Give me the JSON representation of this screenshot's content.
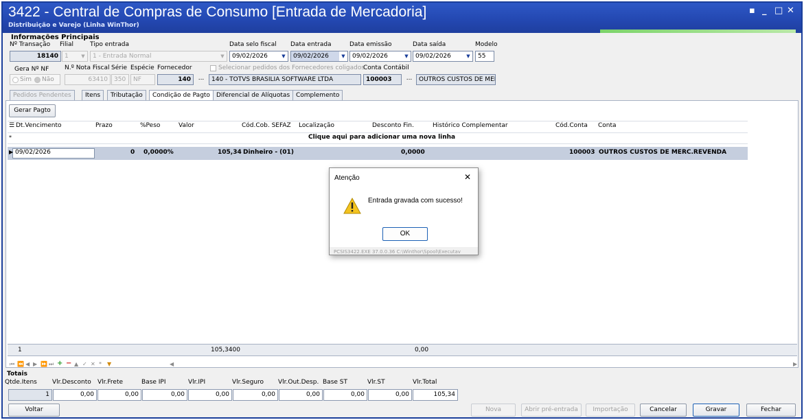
{
  "window": {
    "title": "3422 - Central de Compras de Consumo [Entrada de Mercadoria]",
    "subtitle": "Distribuição e Varejo (Linha WinThor)",
    "controls": [
      "▪",
      "_",
      "□",
      "✕"
    ]
  },
  "header": {
    "section_title": "Informações Principais",
    "labels": {
      "nr_transacao": "Nº Transação",
      "filial": "Filial",
      "tipo_entrada": "Tipo entrada",
      "data_selo": "Data selo fiscal",
      "data_entrada": "Data entrada",
      "data_emissao": "Data emissão",
      "data_saida": "Data saída",
      "modelo": "Modelo",
      "gera_nf": "Gera Nº NF",
      "nota_fiscal": "N.º Nota Fiscal",
      "serie": "Série",
      "especie": "Espécie",
      "fornecedor": "Fornecedor",
      "conta_contabil": "Conta Contábil",
      "sim": "Sim",
      "nao": "Não",
      "selecionar_pedidos": "Selecionar pedidos dos Fornecedores coligados"
    },
    "values": {
      "nr_transacao": "18140",
      "filial": "1",
      "tipo_entrada": "1 - Entrada Normal",
      "data_selo": "09/02/2026",
      "data_entrada": "09/02/2026",
      "data_emissao": "09/02/2026",
      "data_saida": "09/02/2026",
      "modelo": "55",
      "nota_fiscal": "63410",
      "serie": "350",
      "especie": "NF",
      "fornecedor_cod": "140",
      "fornecedor_nome": "140 - TOTVS BRASILIA SOFTWARE LTDA",
      "conta_cod": "100003",
      "conta_nome": "OUTROS CUSTOS DE MEF"
    }
  },
  "tabs": [
    "Pedidos Pendentes",
    "Itens",
    "Tributação",
    "Condição de Pagto",
    "Diferencial de Alíquotas",
    "Complemento"
  ],
  "panel": {
    "gerar_pagto": "Gerar Pagto",
    "columns": [
      "Dt.Vencimento",
      "Prazo",
      "%Peso",
      "Valor",
      "Cód.Cob. SEFAZ",
      "Localização",
      "Desconto Fin.",
      "Histórico Complementar",
      "Cód.Conta",
      "Conta"
    ],
    "new_row_hint": "Clique aqui para adicionar uma nova linha",
    "rows": [
      {
        "vencimento": "09/02/2026",
        "prazo": "0",
        "peso": "0,0000%",
        "valor": "105,34",
        "cobranca": "Dinheiro - (01)",
        "localizacao": "",
        "desconto": "0,0000",
        "historico": "",
        "cod_conta": "100003",
        "conta": "OUTROS CUSTOS DE MERC.REVENDA"
      }
    ],
    "footer": {
      "count": "1",
      "valor": "105,3400",
      "desconto": "0,00"
    }
  },
  "dialog": {
    "title": "Atenção",
    "message": "Entrada gravada com sucesso!",
    "ok": "OK",
    "status": "PCSIS3422.EXE 37.0.0.36 C:\\Winthor\\Spool\\Executav"
  },
  "totais": {
    "title": "Totais",
    "labels": [
      "Qtde.Itens",
      "Vlr.Desconto",
      "Vlr.Frete",
      "Base IPI",
      "Vlr.IPI",
      "Vlr.Seguro",
      "Vlr.Out.Desp.",
      "Base ST",
      "Vlr.ST",
      "Vlr.Total"
    ],
    "values": [
      "1",
      "0,00",
      "0,00",
      "0,00",
      "0,00",
      "0,00",
      "0,00",
      "0,00",
      "0,00",
      "105,34"
    ]
  },
  "footer_buttons": {
    "voltar": "Voltar",
    "nova": "Nova",
    "abrir_pre": "Abrir pré-entrada",
    "importacao": "Importação",
    "cancelar": "Cancelar",
    "gravar": "Gravar",
    "fechar": "Fechar"
  },
  "colors": {
    "title_bar": "#2347b0",
    "selected_row": "#c5cede",
    "accent": "#1a5fb4"
  }
}
